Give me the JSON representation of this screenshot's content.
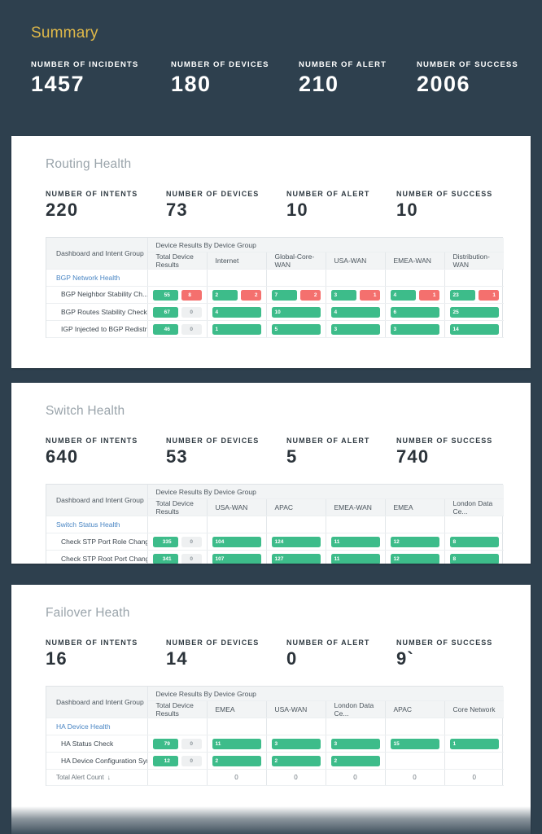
{
  "summary": {
    "title": "Summary",
    "stats": [
      {
        "label": "NUMBER OF INCIDENTS",
        "value": "1457"
      },
      {
        "label": "NUMBER OF DEVICES",
        "value": "180"
      },
      {
        "label": "NUMBER OF ALERT",
        "value": "210"
      },
      {
        "label": "NUMBER OF SUCCESS",
        "value": "2006"
      }
    ]
  },
  "colors": {
    "background": "#2e404e",
    "card": "#ffffff",
    "accent_yellow": "#e0b949",
    "success_green": "#3dbc8a",
    "alert_red": "#f4706e",
    "zero_grey": "#eef0f1",
    "link_blue": "#4a86c4"
  },
  "common": {
    "col_group_header": "Dashboard and Intent Group",
    "col_span_header": "Device Results By Device Group",
    "col_total": "Total Device Results",
    "link_icon": "link-icon",
    "total_label": "Total Alert Count",
    "sort_icon": "arrow-down-icon"
  },
  "cards": [
    {
      "id": "routing",
      "title": "Routing Health",
      "stats": [
        {
          "label": "NUMBER OF INTENTS",
          "value": "220"
        },
        {
          "label": "NUMBER OF DEVICES",
          "value": "73"
        },
        {
          "label": "NUMBER OF ALERT",
          "value": "10"
        },
        {
          "label": "NUMBER OF SUCCESS",
          "value": "10"
        }
      ],
      "columns": [
        "Total Device Results",
        "Internet",
        "Global-Core-WAN",
        "USA-WAN",
        "EMEA-WAN",
        "Distribution-WAN"
      ],
      "group": "BGP Network Health",
      "rows": [
        {
          "name": "BGP Neighbor Stability Ch...",
          "has_link": true,
          "cells": [
            {
              "success": 55,
              "alert": 8
            },
            {
              "success": 2,
              "alert": 2
            },
            {
              "success": 7,
              "alert": 2
            },
            {
              "success": 3,
              "alert": 1
            },
            {
              "success": 4,
              "alert": 1
            },
            {
              "success": 23,
              "alert": 1
            }
          ]
        },
        {
          "name": "BGP Routes Stability Check",
          "has_link": false,
          "cells": [
            {
              "success": 67,
              "alert": 0
            },
            {
              "success": 4,
              "alert": null
            },
            {
              "success": 10,
              "alert": null
            },
            {
              "success": 4,
              "alert": null
            },
            {
              "success": 6,
              "alert": null
            },
            {
              "success": 25,
              "alert": null
            }
          ]
        },
        {
          "name": "IGP Injected to BGP Redistrib...",
          "has_link": false,
          "cells": [
            {
              "success": 46,
              "alert": 0
            },
            {
              "success": 1,
              "alert": null
            },
            {
              "success": 5,
              "alert": null
            },
            {
              "success": 3,
              "alert": null
            },
            {
              "success": 3,
              "alert": null
            },
            {
              "success": 14,
              "alert": null
            }
          ]
        }
      ],
      "total_row": null
    },
    {
      "id": "switch",
      "title": "Switch Health",
      "stats": [
        {
          "label": "NUMBER OF INTENTS",
          "value": "640"
        },
        {
          "label": "NUMBER OF DEVICES",
          "value": "53"
        },
        {
          "label": "NUMBER OF ALERT",
          "value": "5"
        },
        {
          "label": "NUMBER OF SUCCESS",
          "value": "740"
        }
      ],
      "columns": [
        "Total Device Results",
        "USA-WAN",
        "APAC",
        "EMEA-WAN",
        "EMEA",
        "London Data Ce..."
      ],
      "group": "Switch Status Health",
      "rows": [
        {
          "name": "Check STP Port Role Change",
          "has_link": false,
          "cells": [
            {
              "success": 335,
              "alert": 0
            },
            {
              "success": 104,
              "alert": null
            },
            {
              "success": 124,
              "alert": null
            },
            {
              "success": 11,
              "alert": null
            },
            {
              "success": 12,
              "alert": null
            },
            {
              "success": 8,
              "alert": null
            }
          ]
        },
        {
          "name": "Check STP Root Port Change",
          "has_link": false,
          "cells": [
            {
              "success": 341,
              "alert": 0
            },
            {
              "success": 107,
              "alert": null
            },
            {
              "success": 127,
              "alert": null
            },
            {
              "success": 11,
              "alert": null
            },
            {
              "success": 12,
              "alert": null
            },
            {
              "success": 8,
              "alert": null
            }
          ]
        }
      ],
      "total_row": null
    },
    {
      "id": "failover",
      "title": "Failover Heath",
      "stats": [
        {
          "label": "NUMBER OF INTENTS",
          "value": "16"
        },
        {
          "label": "NUMBER OF DEVICES",
          "value": "14"
        },
        {
          "label": "NUMBER OF ALERT",
          "value": "0"
        },
        {
          "label": "NUMBER OF SUCCESS",
          "value": "9`"
        }
      ],
      "columns": [
        "Total Device Results",
        "EMEA",
        "USA-WAN",
        "London Data Ce...",
        "APAC",
        "Core Network"
      ],
      "group": "HA Device Health",
      "rows": [
        {
          "name": "HA Status Check",
          "has_link": false,
          "cells": [
            {
              "success": 79,
              "alert": 0
            },
            {
              "success": 11,
              "alert": null
            },
            {
              "success": 3,
              "alert": null
            },
            {
              "success": 3,
              "alert": null
            },
            {
              "success": 15,
              "alert": null
            },
            {
              "success": 1,
              "alert": null
            }
          ]
        },
        {
          "name": "HA Device Configuration Sync...",
          "has_link": false,
          "cells": [
            {
              "success": 12,
              "alert": 0
            },
            {
              "success": 2,
              "alert": null
            },
            {
              "success": 2,
              "alert": null
            },
            {
              "success": 2,
              "alert": null
            },
            {
              "success": null,
              "alert": null
            },
            {
              "success": null,
              "alert": null
            }
          ]
        }
      ],
      "total_row": {
        "label": "Total Alert Count",
        "values": [
          "",
          "0",
          "0",
          "0",
          "0",
          "0"
        ]
      }
    }
  ]
}
